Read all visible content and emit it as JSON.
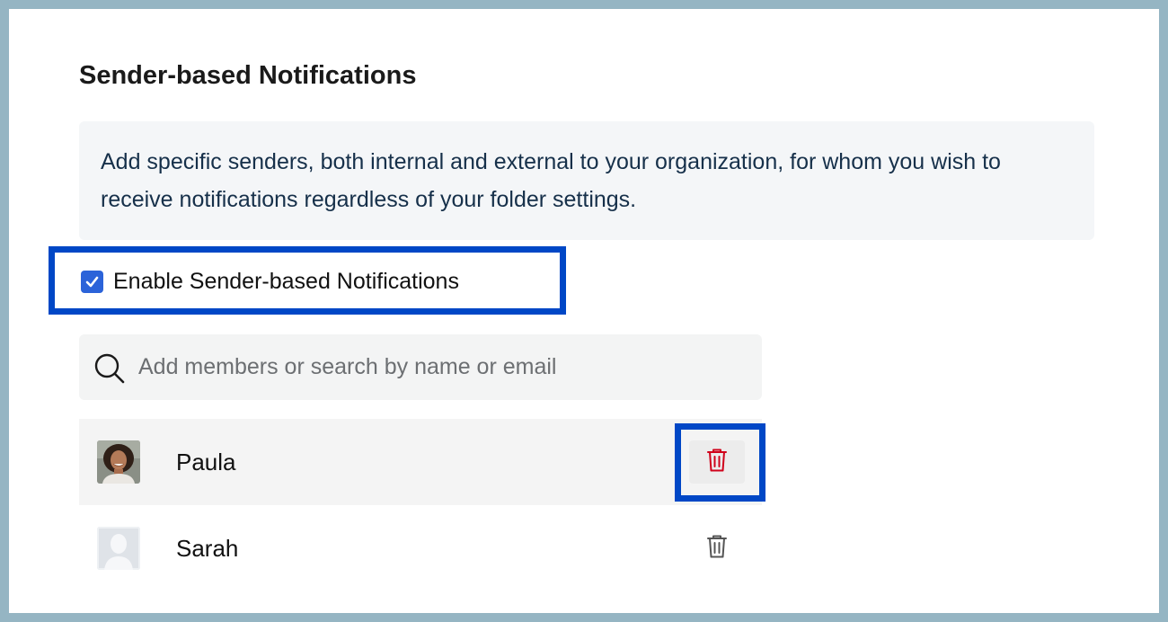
{
  "section": {
    "title": "Sender-based Notifications",
    "description": "Add specific senders, both internal and external to your organization, for whom you wish to receive notifications regardless of your folder settings."
  },
  "enable_checkbox": {
    "label": "Enable Sender-based Notifications",
    "checked": true,
    "color": "#2b63d9"
  },
  "search": {
    "placeholder": "Add members or search by name or email",
    "value": "",
    "icon": "search-icon"
  },
  "members": [
    {
      "name": "Paula",
      "avatar": "photo-avatar",
      "delete_icon": "trash-icon",
      "delete_color": "#d0021b"
    },
    {
      "name": "Sarah",
      "avatar": "placeholder-avatar",
      "delete_icon": "trash-icon",
      "delete_color": "#555555"
    }
  ],
  "colors": {
    "highlight": "#0047c6",
    "background": "#95b5c3",
    "info_box": "#f4f6f8"
  }
}
